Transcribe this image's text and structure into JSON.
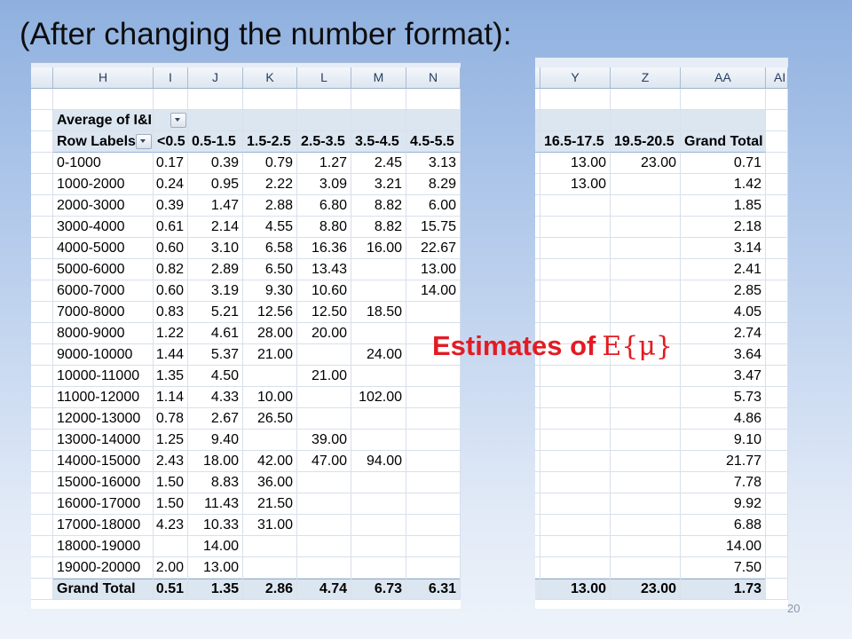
{
  "slide": {
    "title": "(After changing the number format):",
    "annotation": {
      "prefix": "Estimates of",
      "expression": "E{μ}"
    },
    "page_number": "20"
  },
  "colors": {
    "annotation_red": "#e31b23",
    "pivot_fill": "#dce6f1",
    "pivot_rule": "#95b3d7",
    "gridline": "#d8e0eb",
    "title_text": "#0d0d0d"
  },
  "left_sheet": {
    "columns": [
      "",
      "H",
      "I",
      "J",
      "K",
      "L",
      "M",
      "N"
    ],
    "pivot": {
      "value_field_label": "Average of I&I Co",
      "row_labels_header": "Row Labels",
      "column_headers": [
        "<0.5",
        "0.5-1.5",
        "1.5-2.5",
        "2.5-3.5",
        "3.5-4.5",
        "4.5-5.5"
      ]
    },
    "rows": [
      {
        "label": "0-1000",
        "values": [
          "0.17",
          "0.39",
          "0.79",
          "1.27",
          "2.45",
          "3.13"
        ]
      },
      {
        "label": "1000-2000",
        "values": [
          "0.24",
          "0.95",
          "2.22",
          "3.09",
          "3.21",
          "8.29"
        ]
      },
      {
        "label": "2000-3000",
        "values": [
          "0.39",
          "1.47",
          "2.88",
          "6.80",
          "8.82",
          "6.00"
        ]
      },
      {
        "label": "3000-4000",
        "values": [
          "0.61",
          "2.14",
          "4.55",
          "8.80",
          "8.82",
          "15.75"
        ]
      },
      {
        "label": "4000-5000",
        "values": [
          "0.60",
          "3.10",
          "6.58",
          "16.36",
          "16.00",
          "22.67"
        ]
      },
      {
        "label": "5000-6000",
        "values": [
          "0.82",
          "2.89",
          "6.50",
          "13.43",
          "",
          "13.00"
        ]
      },
      {
        "label": "6000-7000",
        "values": [
          "0.60",
          "3.19",
          "9.30",
          "10.60",
          "",
          "14.00"
        ]
      },
      {
        "label": "7000-8000",
        "values": [
          "0.83",
          "5.21",
          "12.56",
          "12.50",
          "18.50",
          ""
        ]
      },
      {
        "label": "8000-9000",
        "values": [
          "1.22",
          "4.61",
          "28.00",
          "20.00",
          "",
          ""
        ]
      },
      {
        "label": "9000-10000",
        "values": [
          "1.44",
          "5.37",
          "21.00",
          "",
          "24.00",
          ""
        ]
      },
      {
        "label": "10000-11000",
        "values": [
          "1.35",
          "4.50",
          "",
          "21.00",
          "",
          ""
        ]
      },
      {
        "label": "11000-12000",
        "values": [
          "1.14",
          "4.33",
          "10.00",
          "",
          "102.00",
          ""
        ]
      },
      {
        "label": "12000-13000",
        "values": [
          "0.78",
          "2.67",
          "26.50",
          "",
          "",
          ""
        ]
      },
      {
        "label": "13000-14000",
        "values": [
          "1.25",
          "9.40",
          "",
          "39.00",
          "",
          ""
        ]
      },
      {
        "label": "14000-15000",
        "values": [
          "2.43",
          "18.00",
          "42.00",
          "47.00",
          "94.00",
          ""
        ]
      },
      {
        "label": "15000-16000",
        "values": [
          "1.50",
          "8.83",
          "36.00",
          "",
          "",
          ""
        ]
      },
      {
        "label": "16000-17000",
        "values": [
          "1.50",
          "11.43",
          "21.50",
          "",
          "",
          ""
        ]
      },
      {
        "label": "17000-18000",
        "values": [
          "4.23",
          "10.33",
          "31.00",
          "",
          "",
          ""
        ]
      },
      {
        "label": "18000-19000",
        "values": [
          "",
          "14.00",
          "",
          "",
          "",
          ""
        ]
      },
      {
        "label": "19000-20000",
        "values": [
          "2.00",
          "13.00",
          "",
          "",
          "",
          ""
        ]
      }
    ],
    "grand_total": {
      "label": "Grand Total",
      "values": [
        "0.51",
        "1.35",
        "2.86",
        "4.74",
        "6.73",
        "6.31"
      ]
    }
  },
  "right_sheet": {
    "columns": [
      "",
      "Y",
      "Z",
      "AA",
      "AI"
    ],
    "pivot": {
      "column_headers": [
        "16.5-17.5",
        "19.5-20.5",
        "Grand Total"
      ]
    },
    "rows": [
      [
        "13.00",
        "23.00",
        "0.71"
      ],
      [
        "13.00",
        "",
        "1.42"
      ],
      [
        "",
        "",
        "1.85"
      ],
      [
        "",
        "",
        "2.18"
      ],
      [
        "",
        "",
        "3.14"
      ],
      [
        "",
        "",
        "2.41"
      ],
      [
        "",
        "",
        "2.85"
      ],
      [
        "",
        "",
        "4.05"
      ],
      [
        "",
        "",
        "2.74"
      ],
      [
        "",
        "",
        "3.64"
      ],
      [
        "",
        "",
        "3.47"
      ],
      [
        "",
        "",
        "5.73"
      ],
      [
        "",
        "",
        "4.86"
      ],
      [
        "",
        "",
        "9.10"
      ],
      [
        "",
        "",
        "21.77"
      ],
      [
        "",
        "",
        "7.78"
      ],
      [
        "",
        "",
        "9.92"
      ],
      [
        "",
        "",
        "6.88"
      ],
      [
        "",
        "",
        "14.00"
      ],
      [
        "",
        "",
        "7.50"
      ]
    ],
    "grand_total": [
      "13.00",
      "23.00",
      "1.73"
    ]
  }
}
